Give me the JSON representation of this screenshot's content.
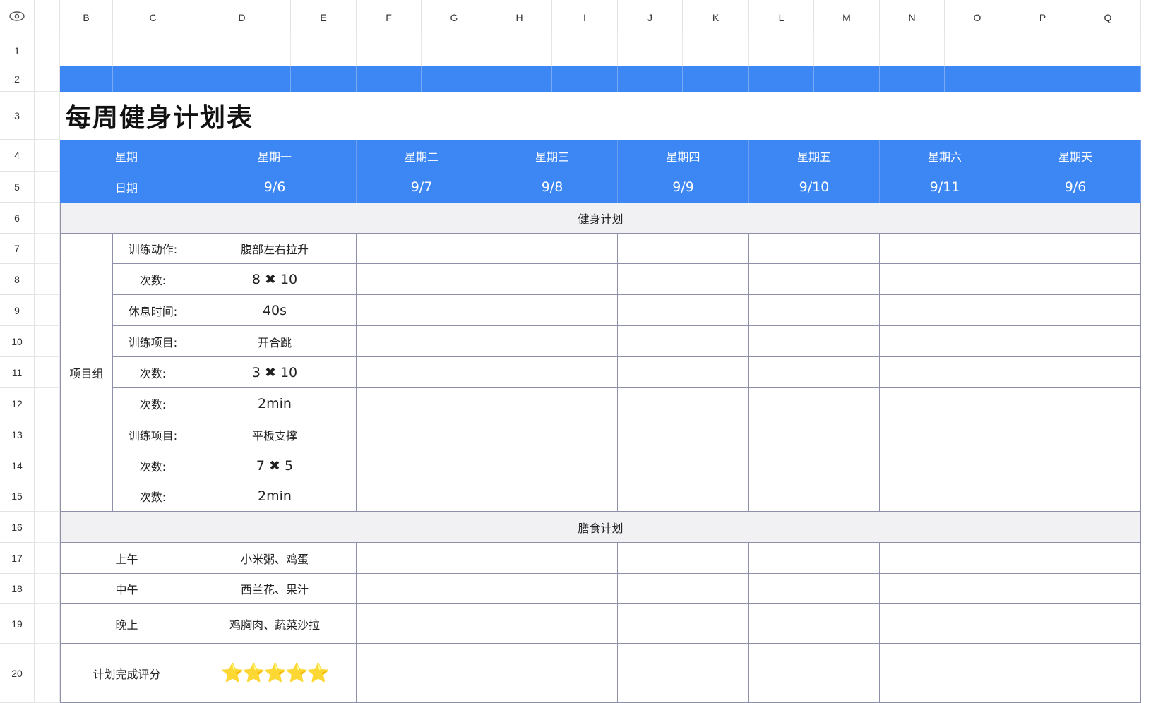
{
  "columns": [
    "B",
    "C",
    "D",
    "E",
    "F",
    "G",
    "H",
    "I",
    "J",
    "K",
    "L",
    "M",
    "N",
    "O",
    "P",
    "Q"
  ],
  "rows": [
    "1",
    "2",
    "3",
    "4",
    "5",
    "6",
    "7",
    "8",
    "9",
    "10",
    "11",
    "12",
    "13",
    "14",
    "15",
    "16",
    "17",
    "18",
    "19",
    "20"
  ],
  "title": "每周健身计划表",
  "weekday_label": "星期",
  "date_label": "日期",
  "days": [
    {
      "weekday": "星期一",
      "date": "9/6"
    },
    {
      "weekday": "星期二",
      "date": "9/7"
    },
    {
      "weekday": "星期三",
      "date": "9/8"
    },
    {
      "weekday": "星期四",
      "date": "9/9"
    },
    {
      "weekday": "星期五",
      "date": "9/10"
    },
    {
      "weekday": "星期六",
      "date": "9/11"
    },
    {
      "weekday": "星期天",
      "date": "9/6"
    }
  ],
  "fitness_section": "健身计划",
  "group_label": "项目组",
  "exercise_rows": [
    {
      "label": "训练动作:",
      "value": "腹部左右拉升"
    },
    {
      "label": "次数:",
      "value": "8 ✖ 10"
    },
    {
      "label": "休息时间:",
      "value": "40s"
    },
    {
      "label": "训练项目:",
      "value": "开合跳"
    },
    {
      "label": "次数:",
      "value": "3 ✖ 10"
    },
    {
      "label": "次数:",
      "value": "2min"
    },
    {
      "label": "训练项目:",
      "value": "平板支撑"
    },
    {
      "label": "次数:",
      "value": "7 ✖ 5"
    },
    {
      "label": "次数:",
      "value": "2min"
    }
  ],
  "diet_section": "膳食计划",
  "meal_rows": [
    {
      "label": "上午",
      "value": "小米粥、鸡蛋"
    },
    {
      "label": "中午",
      "value": "西兰花、果汁"
    },
    {
      "label": "晚上",
      "value": "鸡胸肉、蔬菜沙拉"
    }
  ],
  "rating_label": "计划完成评分",
  "rating_stars": "⭐⭐⭐⭐⭐",
  "rating_value": 5,
  "colors": {
    "accent": "#3d87f5",
    "section_bg": "#f1f1f3",
    "border": "#8d90a8"
  },
  "icons": {
    "corner": "eye-icon"
  }
}
